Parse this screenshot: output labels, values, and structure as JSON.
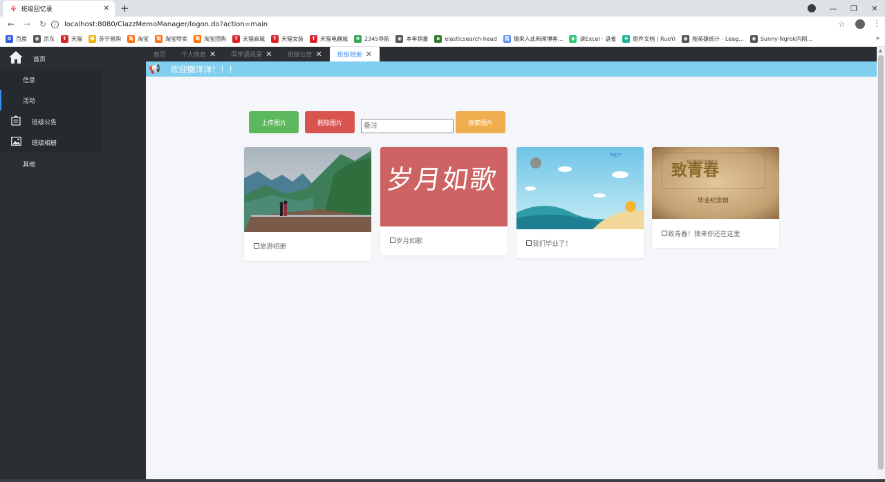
{
  "browser": {
    "tab_title": "班级回忆录",
    "new_tab": "+",
    "url": "localhost:8080/ClazzMemoManager/logon.do?action=main",
    "bookmarks": [
      {
        "label": "百度",
        "color": "#2d5cdc",
        "glyph": "✿"
      },
      {
        "label": "京东",
        "color": "#555555",
        "glyph": "◉"
      },
      {
        "label": "天猫",
        "color": "#d9242a",
        "glyph": "T"
      },
      {
        "label": "苏宁易购",
        "color": "#f0b400",
        "glyph": "☻"
      },
      {
        "label": "淘宝",
        "color": "#ff6a00",
        "glyph": "淘"
      },
      {
        "label": "淘宝特卖",
        "color": "#ff6a00",
        "glyph": "淘"
      },
      {
        "label": "淘宝团购",
        "color": "#ff6a00",
        "glyph": "淘"
      },
      {
        "label": "天猫商城",
        "color": "#d9242a",
        "glyph": "T"
      },
      {
        "label": "天猫女装",
        "color": "#d9242a",
        "glyph": "T"
      },
      {
        "label": "天猫电器城",
        "color": "#d9242a",
        "glyph": "T"
      },
      {
        "label": "2345导航",
        "color": "#3aa655",
        "glyph": "❀"
      },
      {
        "label": "本年销量",
        "color": "#555555",
        "glyph": "◉"
      },
      {
        "label": "elasticsearch-head",
        "color": "#2f7d32",
        "glyph": "e"
      },
      {
        "label": "猿来入此新闻博客...",
        "color": "#5b8def",
        "glyph": "猿"
      },
      {
        "label": "读Excel · 语雀",
        "color": "#2ecc71",
        "glyph": "◆"
      },
      {
        "label": "组件文档 | RuoYi",
        "color": "#1ab394",
        "glyph": "❋"
      },
      {
        "label": "按英雄统计 - Leag...",
        "color": "#555555",
        "glyph": "◉"
      },
      {
        "label": "Sunny-Ngrok内网...",
        "color": "#555555",
        "glyph": "◉"
      }
    ],
    "bookmarks_more": "»"
  },
  "sidebar": {
    "home": "首页",
    "items": [
      {
        "label": "信息",
        "icon": "",
        "active": false
      },
      {
        "label": "活动",
        "icon": "",
        "active": true
      },
      {
        "label": "班级公告",
        "icon": "notice-icon",
        "active": false
      },
      {
        "label": "班级相册",
        "icon": "image-icon",
        "active": false
      },
      {
        "label": "其他",
        "icon": "",
        "active": false
      }
    ]
  },
  "tabs": [
    {
      "label": "首页",
      "closable": false,
      "active": false
    },
    {
      "label": "个人信息",
      "closable": true,
      "active": false
    },
    {
      "label": "同学通讯录",
      "closable": true,
      "active": false
    },
    {
      "label": "班级公告",
      "closable": true,
      "active": false
    },
    {
      "label": "班级相册",
      "closable": true,
      "active": true
    }
  ],
  "banner": {
    "message": "欢迎懒洋洋！！！",
    "color": "#80cfee"
  },
  "toolbar": {
    "upload_label": "上传图片",
    "delete_label": "删除图片",
    "note_placeholder": "备注",
    "search_label": "搜索图片"
  },
  "colors": {
    "success": "#5cb85c",
    "danger": "#d9534f",
    "warning": "#f0ad4e",
    "accent": "#3b8ff5"
  },
  "albums": [
    {
      "caption": "旅游相册",
      "art": "mountain-photo"
    },
    {
      "caption": "岁月如歌",
      "art": "calligraphy-sui-yue-ru-ge",
      "art_text": "岁月如歌"
    },
    {
      "caption": "我们毕业了！",
      "art": "graduation-beach-cartoon",
      "art_text": "毕业了!"
    },
    {
      "caption": "致青春！猿来你还在这里",
      "art": "graduation-book-cover",
      "art_title": "致青春",
      "art_small": "我们的那段青春年华",
      "art_banner": "毕业纪念册"
    }
  ]
}
